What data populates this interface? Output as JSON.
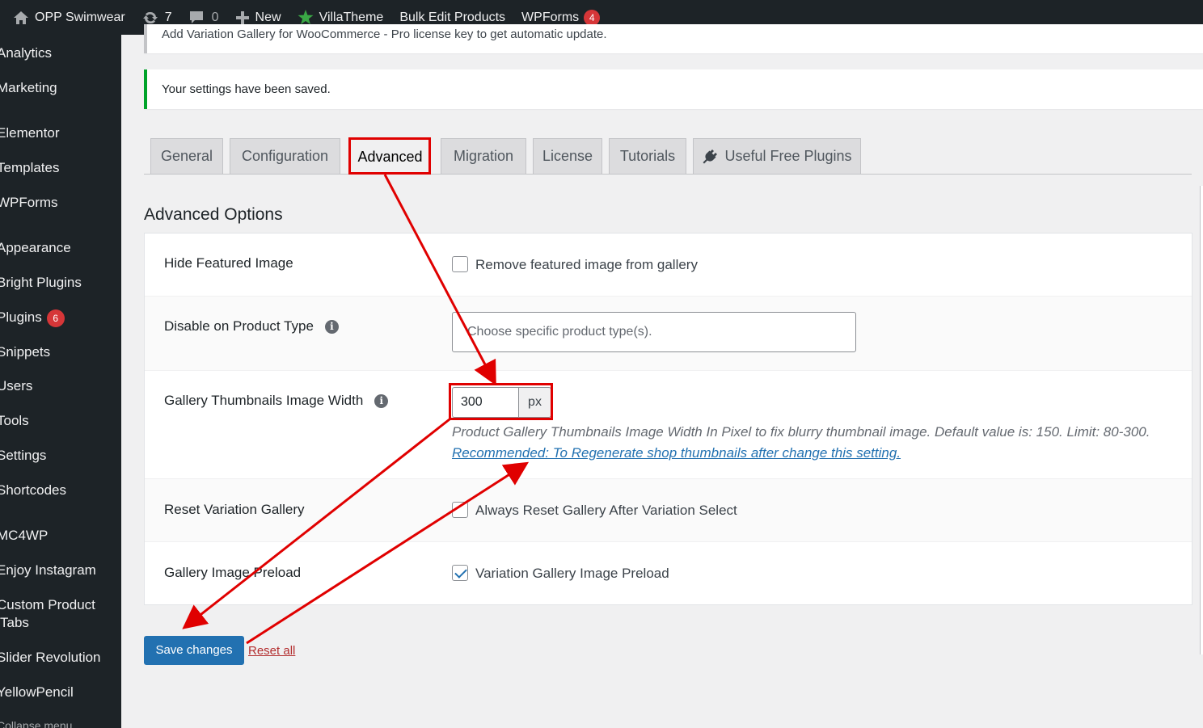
{
  "admin_bar": {
    "site_name": "OPP Swimwear",
    "updates_count": "7",
    "comments_count": "0",
    "new_label": "New",
    "villatheme_label": "VillaTheme",
    "bulk_edit_label": "Bulk Edit Products",
    "wpforms_label": "WPForms",
    "wpforms_badge": "4"
  },
  "sidebar": {
    "items": [
      {
        "label": "Analytics"
      },
      {
        "label": "Marketing"
      },
      {
        "label": "Elementor"
      },
      {
        "label": "Templates"
      },
      {
        "label": "WPForms"
      },
      {
        "label": "Appearance"
      },
      {
        "label": "Bright Plugins"
      },
      {
        "label": "Plugins",
        "badge": "6"
      },
      {
        "label": "Snippets"
      },
      {
        "label": "Users"
      },
      {
        "label": "Tools"
      },
      {
        "label": "Settings"
      },
      {
        "label": "Shortcodes"
      },
      {
        "label": "MC4WP"
      },
      {
        "label": "Enjoy Instagram"
      },
      {
        "label": "Custom Product Tabs"
      },
      {
        "label": "Slider Revolution"
      },
      {
        "label": "YellowPencil"
      }
    ],
    "collapse_label": "Collapse menu"
  },
  "notices": {
    "license": "Add Variation Gallery for WooCommerce - Pro license key to get automatic update.",
    "saved": "Your settings have been saved."
  },
  "tabs": [
    {
      "label": "General"
    },
    {
      "label": "Configuration"
    },
    {
      "label": "Advanced",
      "active": true
    },
    {
      "label": "Migration"
    },
    {
      "label": "License"
    },
    {
      "label": "Tutorials"
    },
    {
      "label": "Useful Free Plugins",
      "icon": "plug-icon"
    }
  ],
  "section_title": "Advanced Options",
  "options": {
    "hide_featured": {
      "label": "Hide Featured Image",
      "checkbox_label": "Remove featured image from gallery",
      "checked": false
    },
    "disable_product_type": {
      "label": "Disable on Product Type",
      "placeholder": "Choose specific product type(s)."
    },
    "thumb_width": {
      "label": "Gallery Thumbnails Image Width",
      "value": "300",
      "unit": "px",
      "description": "Product Gallery Thumbnails Image Width In Pixel to fix blurry thumbnail image. Default value is: 150. Limit: 80-300.",
      "link": "Recommended: To Regenerate shop thumbnails after change this setting."
    },
    "reset_gallery": {
      "label": "Reset Variation Gallery",
      "checkbox_label": "Always Reset Gallery After Variation Select",
      "checked": false
    },
    "preload": {
      "label": "Gallery Image Preload",
      "checkbox_label": "Variation Gallery Image Preload",
      "checked": true
    }
  },
  "buttons": {
    "save": "Save changes",
    "reset": "Reset all"
  },
  "colors": {
    "adminbar_bg": "#1d2327",
    "accent_blue": "#2271b1",
    "success_green": "#00a32a",
    "badge_red": "#d63638",
    "annotation_red": "#e00000"
  }
}
